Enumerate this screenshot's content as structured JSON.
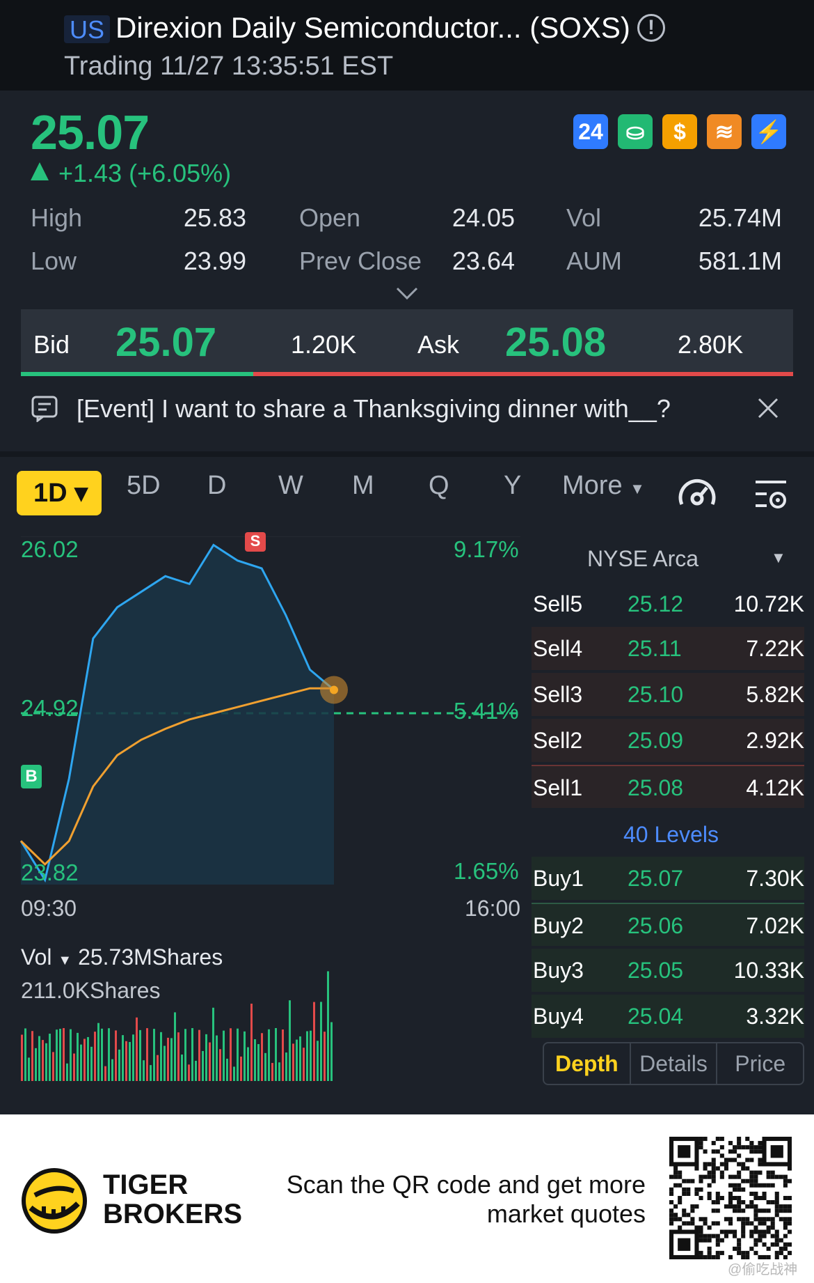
{
  "header": {
    "market": "US",
    "title": "Direxion Daily Semiconductor... (SOXS)",
    "status": "Trading 11/27 13:35:51 EST"
  },
  "quote": {
    "price": "25.07",
    "change": "+1.43 (+6.05%)",
    "badges": [
      {
        "label": "24",
        "color": "#2f7bff"
      },
      {
        "label": "⛀",
        "color": "#22b973"
      },
      {
        "label": "$",
        "color": "#f5a000"
      },
      {
        "label": "≋",
        "color": "#f08a24"
      },
      {
        "label": "⚡",
        "color": "#2f7bff"
      }
    ],
    "stats": [
      {
        "label": "High",
        "value": "25.83"
      },
      {
        "label": "Open",
        "value": "24.05"
      },
      {
        "label": "Vol",
        "value": "25.74M"
      },
      {
        "label": "Low",
        "value": "23.99"
      },
      {
        "label": "Prev Close",
        "value": "23.64"
      },
      {
        "label": "AUM",
        "value": "581.1M"
      }
    ]
  },
  "bidask": {
    "bid_label": "Bid",
    "bid": "25.07",
    "bid_size": "1.20K",
    "ask_label": "Ask",
    "ask": "25.08",
    "ask_size": "2.80K"
  },
  "event": {
    "text": "[Event] I want to share a Thanksgiving dinner with__?"
  },
  "tabs": {
    "active": "1D",
    "items": [
      "5D",
      "D",
      "W",
      "M",
      "Q",
      "Y"
    ],
    "more": "More"
  },
  "chart": {
    "high_label": "26.02",
    "mid_label": "24.92",
    "low_label": "23.82",
    "pct_high": "9.17%",
    "pct_mid": "5.41%",
    "pct_low": "1.65%",
    "t_start": "09:30",
    "t_end": "16:00",
    "marker_s": "S",
    "marker_b": "B",
    "vol_label": "Vol",
    "vol_total": "25.73MShares",
    "vol_max": "211.0KShares"
  },
  "chart_data": {
    "type": "line",
    "title": "",
    "xlabel": "",
    "ylabel": "",
    "ylim": [
      23.82,
      26.02
    ],
    "x": [
      "09:30",
      "09:40",
      "09:50",
      "10:00",
      "10:15",
      "10:30",
      "11:00",
      "11:30",
      "12:00",
      "12:30",
      "13:00",
      "13:15",
      "13:30",
      "13:35"
    ],
    "series": [
      {
        "values": [
          24.1,
          23.85,
          24.5,
          25.4,
          25.6,
          25.7,
          25.8,
          25.75,
          26.0,
          25.9,
          25.85,
          25.55,
          25.2,
          25.07
        ]
      },
      {
        "values": [
          24.1,
          23.95,
          24.1,
          24.45,
          24.65,
          24.75,
          24.82,
          24.88,
          24.92,
          24.96,
          25.0,
          25.04,
          25.08,
          25.08
        ]
      }
    ],
    "volume_max": "211.0KShares",
    "volume_total": "25.73MShares"
  },
  "orderbook": {
    "exchange": "NYSE Arca",
    "sells": [
      {
        "label": "Sell5",
        "price": "25.12",
        "size": "10.72K"
      },
      {
        "label": "Sell4",
        "price": "25.11",
        "size": "7.22K"
      },
      {
        "label": "Sell3",
        "price": "25.10",
        "size": "5.82K"
      },
      {
        "label": "Sell2",
        "price": "25.09",
        "size": "2.92K"
      },
      {
        "label": "Sell1",
        "price": "25.08",
        "size": "4.12K"
      }
    ],
    "levels": "40 Levels",
    "buys": [
      {
        "label": "Buy1",
        "price": "25.07",
        "size": "7.30K"
      },
      {
        "label": "Buy2",
        "price": "25.06",
        "size": "7.02K"
      },
      {
        "label": "Buy3",
        "price": "25.05",
        "size": "10.33K"
      },
      {
        "label": "Buy4",
        "price": "25.04",
        "size": "3.32K"
      }
    ],
    "tabs": [
      "Depth",
      "Details",
      "Price"
    ]
  },
  "footer": {
    "brand_line1": "TIGER",
    "brand_line2": "BROKERS",
    "scan_line1": "Scan the QR code and get more",
    "scan_line2": "market quotes",
    "watermark": "@偷吃战神"
  }
}
